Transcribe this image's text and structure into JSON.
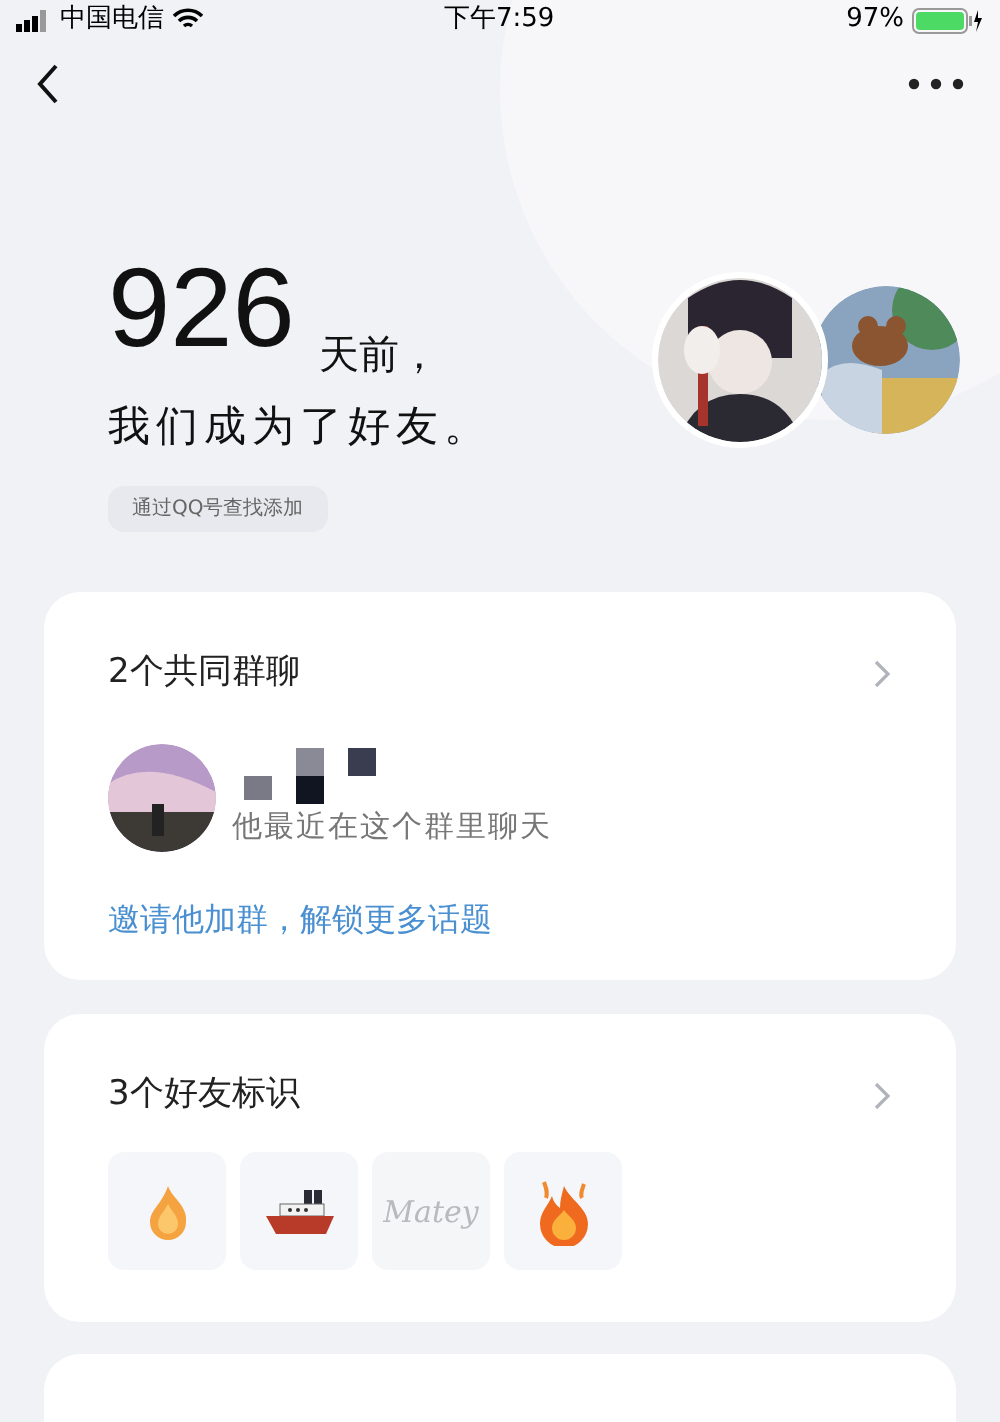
{
  "status_bar": {
    "carrier": "中国电信",
    "time": "下午7:59",
    "battery": "97%"
  },
  "header": {
    "days": "926",
    "days_suffix": "天前，",
    "line2": "我们成为了好友。",
    "source_tag": "通过QQ号查找添加"
  },
  "groups_card": {
    "title": "2个共同群聊",
    "recent_text": "他最近在这个群里聊天",
    "invite_link": "邀请他加群，解锁更多话题"
  },
  "badges_card": {
    "title": "3个好友标识",
    "badges": [
      {
        "kind": "flame",
        "lit": true
      },
      {
        "kind": "ship",
        "lit": true
      },
      {
        "kind": "script",
        "label": "Matey",
        "lit": false
      },
      {
        "kind": "bigflame",
        "lit": true
      }
    ]
  }
}
